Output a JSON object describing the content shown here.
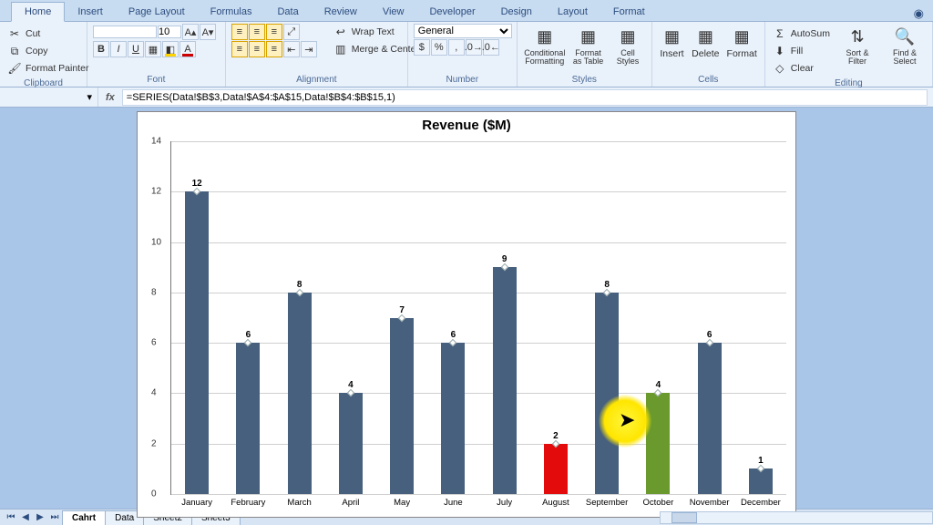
{
  "ribbon": {
    "tabs": [
      "Home",
      "Insert",
      "Page Layout",
      "Formulas",
      "Data",
      "Review",
      "View",
      "Developer",
      "Design",
      "Layout",
      "Format"
    ],
    "active_tab": "Home",
    "clipboard": {
      "cut": "Cut",
      "copy": "Copy",
      "fp": "Format Painter",
      "label": "Clipboard"
    },
    "font": {
      "size": "10",
      "label": "Font"
    },
    "alignment": {
      "wrap": "Wrap Text",
      "merge": "Merge & Center",
      "label": "Alignment"
    },
    "number": {
      "format": "General",
      "label": "Number"
    },
    "styles": {
      "cf": "Conditional Formatting",
      "fat": "Format as Table",
      "cs": "Cell Styles",
      "label": "Styles"
    },
    "cells": {
      "insert": "Insert",
      "delete": "Delete",
      "format": "Format",
      "label": "Cells"
    },
    "editing": {
      "autosum": "AutoSum",
      "fill": "Fill",
      "clear": "Clear",
      "sort": "Sort & Filter",
      "find": "Find & Select",
      "label": "Editing"
    }
  },
  "formula_bar": {
    "fx": "fx",
    "formula": "=SERIES(Data!$B$3,Data!$A$4:$A$15,Data!$B$4:$B$15,1)"
  },
  "chart_data": {
    "type": "bar",
    "title": "Revenue ($M)",
    "categories": [
      "January",
      "February",
      "March",
      "April",
      "May",
      "June",
      "July",
      "August",
      "September",
      "October",
      "November",
      "December"
    ],
    "values": [
      12,
      6,
      8,
      4,
      7,
      6,
      9,
      2,
      8,
      4,
      6,
      1
    ],
    "colors": [
      "#46607e",
      "#46607e",
      "#46607e",
      "#46607e",
      "#46607e",
      "#46607e",
      "#46607e",
      "#e30b0b",
      "#46607e",
      "#6a9a2e",
      "#46607e",
      "#46607e"
    ],
    "ylim": [
      0,
      14
    ],
    "yticks": [
      0,
      2,
      4,
      6,
      8,
      10,
      12,
      14
    ],
    "xlabel": "",
    "ylabel": ""
  },
  "sheet_tabs": {
    "items": [
      "Cahrt",
      "Data",
      "Sheet2",
      "Sheet3"
    ],
    "active": "Cahrt"
  }
}
